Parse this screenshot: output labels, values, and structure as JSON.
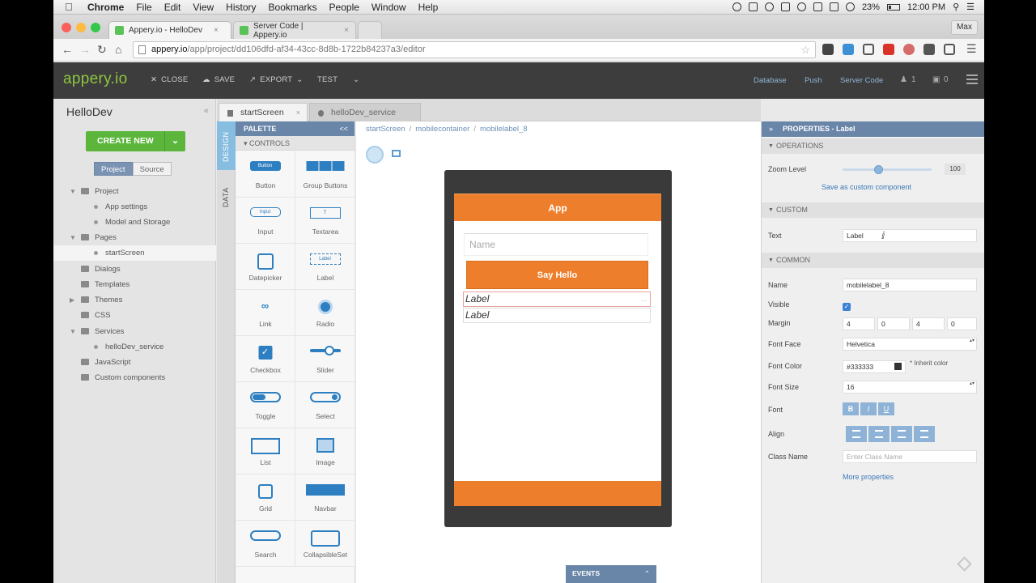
{
  "menubar": {
    "app": "Chrome",
    "items": [
      "File",
      "Edit",
      "View",
      "History",
      "Bookmarks",
      "People",
      "Window",
      "Help"
    ],
    "battery": "23%",
    "clock": "12:00 PM"
  },
  "browser": {
    "tabs": [
      {
        "title": "Appery.io - HelloDev",
        "close": "×"
      },
      {
        "title": "Server Code | Appery.io",
        "close": "×"
      }
    ],
    "profile": "Max",
    "url_host": "appery.io",
    "url_path": "/app/project/dd106dfd-af34-43cc-8d8b-1722b84237a3/editor"
  },
  "apptop": {
    "logo": "appery.io",
    "close": "CLOSE",
    "save": "SAVE",
    "export": "EXPORT",
    "test": "TEST",
    "database": "Database",
    "push": "Push",
    "server_code": "Server Code",
    "users_count": "1",
    "locks_count": "0"
  },
  "project": {
    "title": "HelloDev",
    "create_new": "CREATE NEW",
    "tab_project": "Project",
    "tab_source": "Source",
    "tree": [
      {
        "label": "Project"
      },
      {
        "label": "App settings"
      },
      {
        "label": "Model and Storage"
      },
      {
        "label": "Pages"
      },
      {
        "label": "startScreen"
      },
      {
        "label": "Dialogs"
      },
      {
        "label": "Templates"
      },
      {
        "label": "Themes"
      },
      {
        "label": "CSS"
      },
      {
        "label": "Services"
      },
      {
        "label": "helloDev_service"
      },
      {
        "label": "JavaScript"
      },
      {
        "label": "Custom components"
      }
    ]
  },
  "editor_tabs": [
    {
      "label": "startScreen",
      "close": "×"
    },
    {
      "label": "helloDev_service"
    }
  ],
  "side_tabs": {
    "design": "DESIGN",
    "data": "DATA"
  },
  "palette": {
    "title": "PALETTE",
    "section": "CONTROLS",
    "collapse": "<<",
    "items": [
      "Button",
      "Group Buttons",
      "Input",
      "Textarea",
      "Datepicker",
      "Label",
      "Link",
      "Radio",
      "Checkbox",
      "Slider",
      "Toggle",
      "Select",
      "List",
      "Image",
      "Grid",
      "Navbar",
      "Search",
      "CollapsibleSet"
    ],
    "button_glyph": "Button",
    "input_glyph": "Input",
    "label_glyph": "Label",
    "textarea_glyph": "T"
  },
  "canvas": {
    "breadcrumb": [
      "startScreen",
      "mobilecontainer",
      "mobilelabel_8"
    ],
    "breadcrumb_sep": "/",
    "header": "App",
    "name_placeholder": "Name",
    "button": "Say Hello",
    "label1": "Label",
    "label2": "Label",
    "label_close": "...",
    "events": "EVENTS"
  },
  "props": {
    "title": "PROPERTIES - Label",
    "operations": "OPERATIONS",
    "zoom_label": "Zoom Level",
    "zoom_value": "100",
    "zoom_fraction": 0.4,
    "save_custom": "Save as custom component",
    "custom": "CUSTOM",
    "text_label": "Text",
    "text_value": "Label",
    "common": "COMMON",
    "name_label": "Name",
    "name_value": "mobilelabel_8",
    "visible_label": "Visible",
    "visible_checked": true,
    "margin_label": "Margin",
    "margins": [
      "4",
      "0",
      "4",
      "0"
    ],
    "fontface_label": "Font Face",
    "fontface_value": "Helvetica",
    "fontcolor_label": "Font Color",
    "fontcolor_value": "#333333",
    "inherit_color": "* Inherit color",
    "fontsize_label": "Font Size",
    "fontsize_value": "16",
    "font_label": "Font",
    "font_buttons": [
      "B",
      "I",
      "U"
    ],
    "align_label": "Align",
    "classname_label": "Class Name",
    "classname_placeholder": "Enter Class Name",
    "more_props": "More properties"
  },
  "colors": {
    "accent_orange": "#ed7f2c",
    "brand_green": "#8dc63f",
    "panel_blue": "#6985a8",
    "palette_blue": "#2d7fc1"
  }
}
